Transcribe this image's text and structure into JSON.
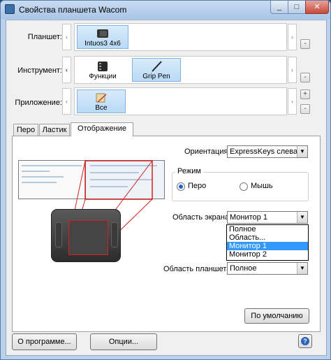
{
  "window": {
    "title": "Свойства планшета Wacom",
    "min_icon": "_",
    "max_icon": "□",
    "close_icon": "✕"
  },
  "rows": {
    "tablet": {
      "label": "Планшет:",
      "items": [
        {
          "label": "Intuos3 4x6",
          "selected": true
        }
      ]
    },
    "tool": {
      "label": "Инструмент:",
      "items": [
        {
          "label": "Функции",
          "selected": false
        },
        {
          "label": "Grip Pen",
          "selected": true
        }
      ]
    },
    "app": {
      "label": "Приложение:",
      "items": [
        {
          "label": "Все",
          "selected": true
        }
      ]
    },
    "prev_arrow": "‹",
    "next_arrow": "›",
    "plus": "+",
    "minus": "-"
  },
  "tabs": [
    {
      "label": "Перо",
      "active": false
    },
    {
      "label": "Ластик",
      "active": false
    },
    {
      "label": "Отображение",
      "active": true
    }
  ],
  "mapping": {
    "orientation_label": "Ориентация:",
    "orientation_value": "ExpressKeys слева",
    "mode_group_title": "Режим",
    "mode_pen": "Перо",
    "mode_mouse": "Мышь",
    "mode_selected": "pen",
    "screen_area_label": "Область экрана:",
    "screen_area_value": "Монитор 1",
    "screen_area_options": [
      {
        "label": "Полное",
        "highlighted": false
      },
      {
        "label": "Область...",
        "highlighted": false
      },
      {
        "label": "Монитор 1",
        "highlighted": true
      },
      {
        "label": "Монитор 2",
        "highlighted": false
      }
    ],
    "tablet_area_label": "Область планшета:",
    "tablet_area_value": "Полное",
    "default_button": "По умолчанию",
    "dropdown_arrow": "▼"
  },
  "footer": {
    "about_button": "О программе...",
    "options_button": "Опции...",
    "help_icon": "?"
  },
  "colors": {
    "accent": "#3399ff",
    "mapping_lines": "#d32020"
  }
}
